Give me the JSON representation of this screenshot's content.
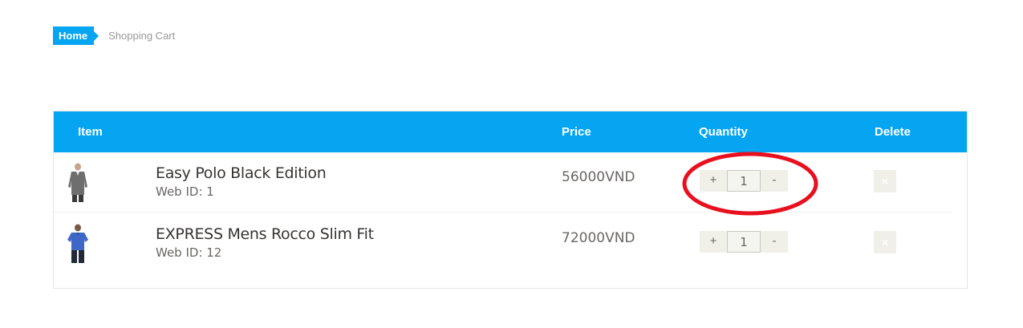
{
  "breadcrumb": {
    "home": "Home",
    "current": "Shopping Cart"
  },
  "table": {
    "headers": {
      "item": "Item",
      "price": "Price",
      "quantity": "Quantity",
      "delete": "Delete"
    },
    "rows": [
      {
        "name": "Easy Polo Black Edition",
        "web_id": "Web ID: 1",
        "price": "56000VND",
        "quantity": "1",
        "plus": "+",
        "minus": "-",
        "delete_icon": "×"
      },
      {
        "name": "EXPRESS Mens Rocco Slim Fit",
        "web_id": "Web ID: 12",
        "price": "72000VND",
        "quantity": "1",
        "plus": "+",
        "minus": "-",
        "delete_icon": "×"
      }
    ]
  },
  "colors": {
    "accent": "#05a5f2",
    "annotation": "#e8101f",
    "button_bg": "#f0f0e9"
  },
  "icons": {
    "row1_thumb": "shirt-grey-icon",
    "row2_thumb": "polo-blue-icon",
    "delete": "close-icon"
  }
}
